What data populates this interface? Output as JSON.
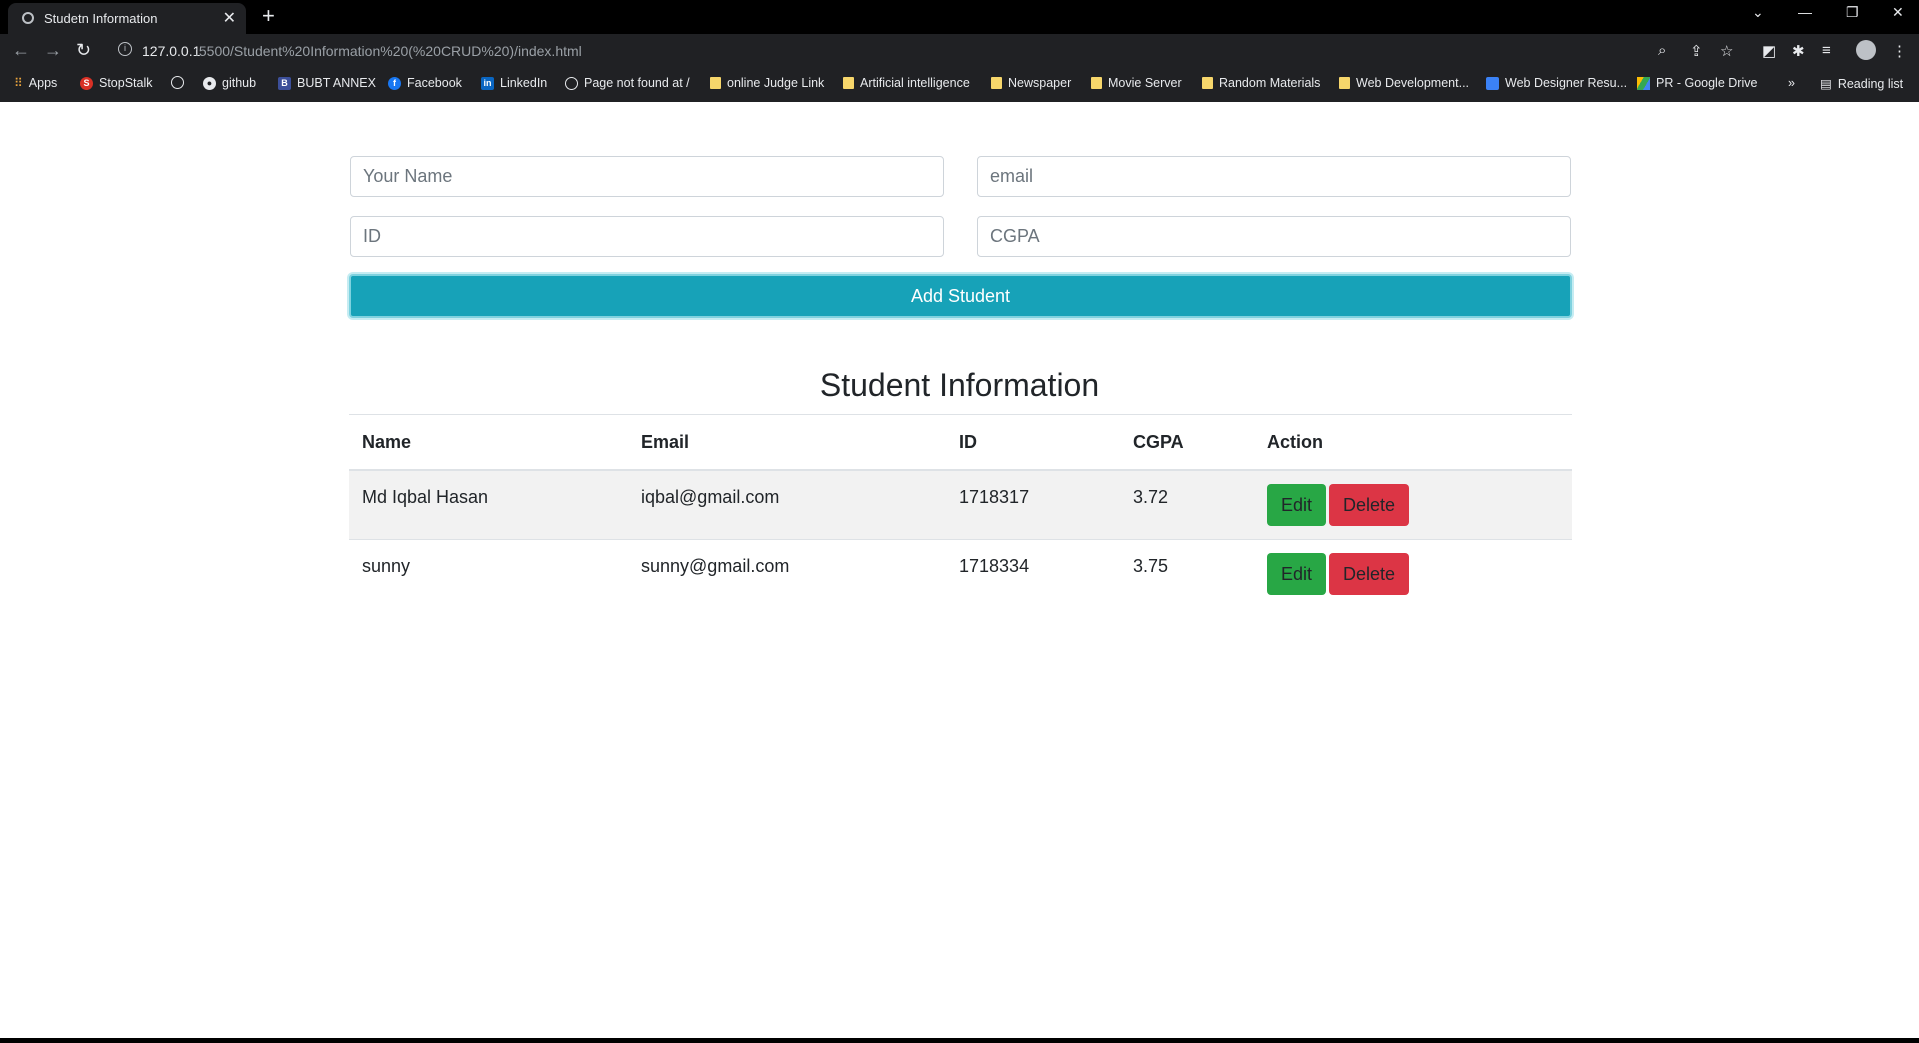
{
  "browser": {
    "tab_title": "Studetn Information",
    "url_host": "127.0.0.1",
    "url_path": ":5500/Student%20Information%20(%20CRUD%20)/index.html",
    "bookmarks": [
      {
        "label": "Apps",
        "icon": "apps-grid-icon"
      },
      {
        "label": "StopStalk",
        "icon": "stopstalk-icon"
      },
      {
        "label": "",
        "icon": "globe-icon"
      },
      {
        "label": "github",
        "icon": "github-icon"
      },
      {
        "label": "BUBT ANNEX",
        "icon": "bubt-icon"
      },
      {
        "label": "Facebook",
        "icon": "facebook-icon"
      },
      {
        "label": "LinkedIn",
        "icon": "linkedin-icon"
      },
      {
        "label": "Page not found at /",
        "icon": "globe-icon"
      },
      {
        "label": "online Judge Link",
        "icon": "folder-icon"
      },
      {
        "label": "Artificial intelligence",
        "icon": "folder-icon"
      },
      {
        "label": "Newspaper",
        "icon": "folder-icon"
      },
      {
        "label": "Movie Server",
        "icon": "folder-icon"
      },
      {
        "label": "Random Materials",
        "icon": "folder-icon"
      },
      {
        "label": "Web Development...",
        "icon": "folder-icon"
      },
      {
        "label": "Web Designer Resu...",
        "icon": "web-designer-icon"
      },
      {
        "label": "PR - Google Drive",
        "icon": "google-drive-icon"
      }
    ],
    "reading_list": "Reading list"
  },
  "form": {
    "name_placeholder": "Your Name",
    "email_placeholder": "email",
    "id_placeholder": "ID",
    "cgpa_placeholder": "CGPA",
    "add_button": "Add Student"
  },
  "heading": "Student Information",
  "table": {
    "headers": [
      "Name",
      "Email",
      "ID",
      "CGPA",
      "Action"
    ],
    "rows": [
      {
        "name": "Md Iqbal Hasan",
        "email": "iqbal@gmail.com",
        "id": "1718317",
        "cgpa": "3.72"
      },
      {
        "name": "sunny",
        "email": "sunny@gmail.com",
        "id": "1718334",
        "cgpa": "3.75"
      }
    ],
    "edit_label": "Edit",
    "delete_label": "Delete"
  },
  "colors": {
    "add_button": "#17a2b8",
    "edit_button": "#28a745",
    "delete_button": "#dc3545"
  }
}
